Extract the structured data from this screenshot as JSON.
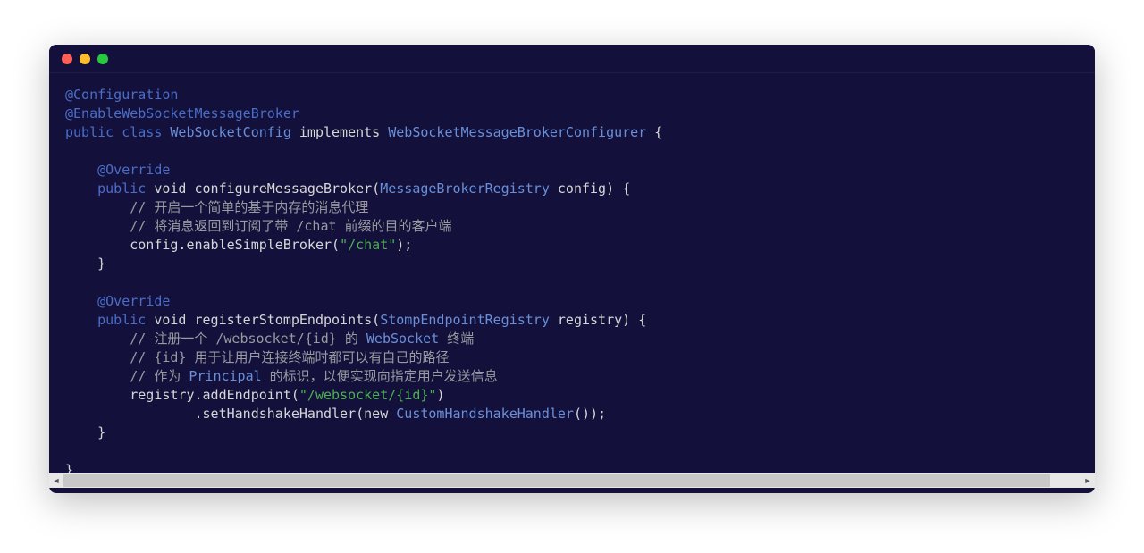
{
  "code": {
    "l1_annot": "@Configuration",
    "l2_annot": "@EnableWebSocketMessageBroker",
    "l3_kw1": "public",
    "l3_kw2": "class",
    "l3_cls1": "WebSocketConfig",
    "l3_impl": "implements",
    "l3_cls2": "WebSocketMessageBrokerConfigurer",
    "l3_brace": " {",
    "l5_annot": "@Override",
    "l6_kw": "public",
    "l6_ret": "void",
    "l6_method": "configureMessageBroker(",
    "l6_cls": "MessageBrokerRegistry",
    "l6_rest": " config) {",
    "l7_com": "// 开启一个简单的基于内存的消息代理",
    "l8_com": "// 将消息返回到订阅了带 /chat 前缀的目的客户端",
    "l9_call1": "config.enableSimpleBroker(",
    "l9_str": "\"/chat\"",
    "l9_rest": ");",
    "l10_brace": "}",
    "l12_annot": "@Override",
    "l13_kw": "public",
    "l13_ret": "void",
    "l13_method": "registerStompEndpoints(",
    "l13_cls": "StompEndpointRegistry",
    "l13_rest": " registry) {",
    "l14_com1": "// 注册一个 /websocket/{id} 的 ",
    "l14_cls": "WebSocket",
    "l14_com2": " 终端",
    "l15_com": "// {id} 用于让用户连接终端时都可以有自己的路径",
    "l16_com1": "// 作为 ",
    "l16_cls": "Principal",
    "l16_com2": " 的标识，以便实现向指定用户发送信息",
    "l17_call": "registry.addEndpoint(",
    "l17_str": "\"/websocket/{id}\"",
    "l17_rest": ")",
    "l18_call1": ".setHandshakeHandler(",
    "l18_kw": "new",
    "l18_cls": "CustomHandshakeHandler",
    "l18_rest": "());",
    "l19_brace": "}",
    "l21_brace": "}"
  }
}
